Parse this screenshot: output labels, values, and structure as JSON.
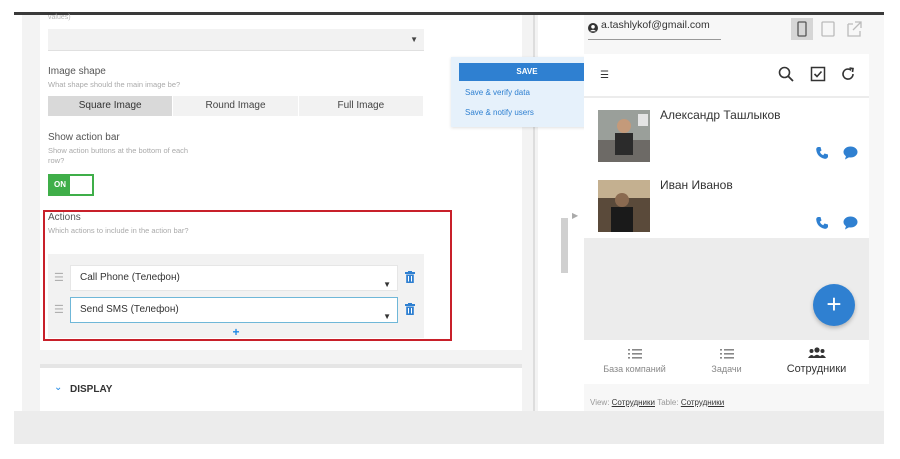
{
  "editor": {
    "faded_text": "values)",
    "image_shape": {
      "label": "Image shape",
      "hint": "What shape should the main image be?",
      "options": [
        "Square Image",
        "Round Image",
        "Full Image"
      ],
      "selected": "Square Image"
    },
    "action_bar": {
      "label": "Show action bar",
      "hint": "Show action buttons at the bottom of each row?",
      "toggle_text": "ON",
      "toggle_state": true
    },
    "actions": {
      "label": "Actions",
      "hint": "Which actions to include in the action bar?",
      "items": [
        {
          "value": "Call Phone (Телефон)"
        },
        {
          "value": "Send SMS (Телефон)"
        }
      ],
      "add_symbol": "+"
    },
    "display_section": "DISPLAY"
  },
  "save_menu": {
    "save": "SAVE",
    "verify": "Save & verify data",
    "notify": "Save & notify users"
  },
  "preview": {
    "account": "a.tashlykof@gmail.com",
    "contacts": [
      {
        "name": "Александр Ташлыков"
      },
      {
        "name": "Иван Иванов"
      }
    ],
    "fab": "+",
    "nav": [
      {
        "label": "База компаний",
        "icon": "list-icon"
      },
      {
        "label": "Задачи",
        "icon": "list-icon"
      },
      {
        "label": "Сотрудники",
        "icon": "people-icon"
      }
    ],
    "footer": {
      "view_label": "View:",
      "view_value": "Сотрудники",
      "table_label": "Table:",
      "table_value": "Сотрудники"
    }
  },
  "colors": {
    "accent": "#2f80d1",
    "toggle_on": "#3fae49",
    "highlight_border": "#c8202a"
  }
}
